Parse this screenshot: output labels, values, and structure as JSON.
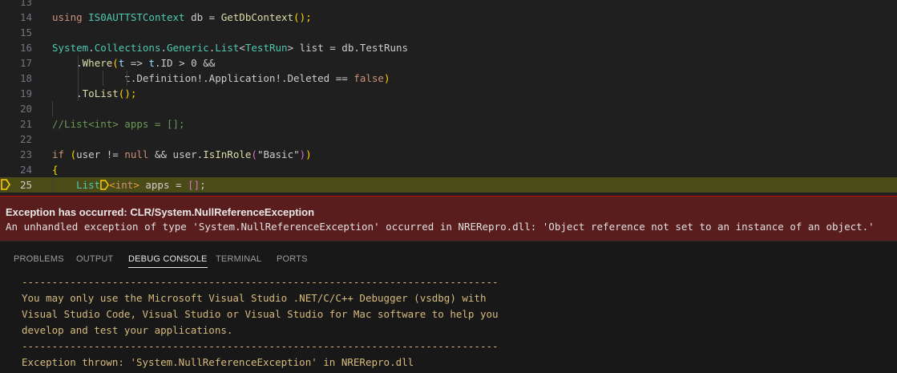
{
  "editor": {
    "lines": [
      {
        "num": "13"
      },
      {
        "num": "14",
        "parts": [
          {
            "t": "using ",
            "c": "kw"
          },
          {
            "t": "IS0AUTTSTContext",
            "c": "typ"
          },
          {
            "t": " db = ",
            "c": "plain"
          },
          {
            "t": "GetDbContext",
            "c": "fn"
          },
          {
            "t": "();",
            "c": "brk1"
          }
        ]
      },
      {
        "num": "15"
      },
      {
        "num": "16",
        "parts": [
          {
            "t": "System",
            "c": "typ"
          },
          {
            "t": ".",
            "c": "plain"
          },
          {
            "t": "Collections",
            "c": "typ"
          },
          {
            "t": ".",
            "c": "plain"
          },
          {
            "t": "Generic",
            "c": "typ"
          },
          {
            "t": ".",
            "c": "plain"
          },
          {
            "t": "List",
            "c": "typ"
          },
          {
            "t": "<",
            "c": "plain"
          },
          {
            "t": "TestRun",
            "c": "typ"
          },
          {
            "t": ">",
            "c": "plain"
          },
          {
            "t": " list = db.TestRuns",
            "c": "plain"
          }
        ]
      },
      {
        "num": "17",
        "parts": [
          {
            "t": "    .",
            "c": "plain"
          },
          {
            "t": "Where",
            "c": "fn"
          },
          {
            "t": "(",
            "c": "brk1"
          },
          {
            "t": "t",
            "c": "var"
          },
          {
            "t": " => ",
            "c": "plain"
          },
          {
            "t": "t",
            "c": "var"
          },
          {
            "t": ".ID > 0 &&",
            "c": "plain"
          }
        ]
      },
      {
        "num": "18",
        "parts": [
          {
            "t": "            t.Definition!.Application!.Deleted == ",
            "c": "plain"
          },
          {
            "t": "false",
            "c": "kw"
          },
          {
            "t": ")",
            "c": "brk1"
          }
        ]
      },
      {
        "num": "19",
        "parts": [
          {
            "t": "    .",
            "c": "plain"
          },
          {
            "t": "ToList",
            "c": "fn"
          },
          {
            "t": "();",
            "c": "brk1"
          }
        ]
      },
      {
        "num": "20"
      },
      {
        "num": "21",
        "parts": [
          {
            "t": "//List<int> apps = [];",
            "c": "cmt"
          }
        ]
      },
      {
        "num": "22"
      },
      {
        "num": "23",
        "parts": [
          {
            "t": "if",
            "c": "kw"
          },
          {
            "t": " ",
            "c": "plain"
          },
          {
            "t": "(",
            "c": "brk1"
          },
          {
            "t": "user != ",
            "c": "plain"
          },
          {
            "t": "null",
            "c": "kw"
          },
          {
            "t": " && user.",
            "c": "plain"
          },
          {
            "t": "IsInRole",
            "c": "fn"
          },
          {
            "t": "(",
            "c": "brk2"
          },
          {
            "t": "\"Basic\"",
            "c": "plain"
          },
          {
            "t": ")",
            "c": "brk2"
          },
          {
            "t": ")",
            "c": "brk1"
          }
        ]
      },
      {
        "num": "24",
        "parts": [
          {
            "t": "{",
            "c": "brk1"
          }
        ]
      },
      {
        "num": "25",
        "current": true,
        "parts": [
          {
            "t": "    List",
            "c": "typ"
          },
          {
            "t": "MARKER",
            "c": "marker"
          },
          {
            "t": "<",
            "c": "org"
          },
          {
            "t": "int",
            "c": "kw"
          },
          {
            "t": ">",
            "c": "org"
          },
          {
            "t": " apps = ",
            "c": "plain"
          },
          {
            "t": "[]",
            "c": "brk2"
          },
          {
            "t": ";",
            "c": "plain"
          }
        ]
      }
    ]
  },
  "exception": {
    "title": "Exception has occurred: CLR/System.NullReferenceException",
    "message": "An unhandled exception of type 'System.NullReferenceException' occurred in NRERepro.dll: 'Object reference not set to an instance of an object.'"
  },
  "panel": {
    "tabs": [
      {
        "label": "PROBLEMS"
      },
      {
        "label": "OUTPUT"
      },
      {
        "label": "DEBUG CONSOLE",
        "active": true
      },
      {
        "label": "TERMINAL"
      },
      {
        "label": "PORTS"
      }
    ],
    "console_lines": [
      "-------------------------------------------------------------------------------",
      "You may only use the Microsoft Visual Studio .NET/C/C++ Debugger (vsdbg) with",
      "Visual Studio Code, Visual Studio or Visual Studio for Mac software to help you",
      "develop and test your applications.",
      "-------------------------------------------------------------------------------",
      "Exception thrown: 'System.NullReferenceException' in NRERepro.dll"
    ]
  },
  "colors": {
    "editor_bg": "#1f1f1f",
    "current_line_bg": "#4b4b18",
    "exception_bg": "#5a1d1d",
    "console_text": "#d7ba7d",
    "breakpoint_marker": "#ffcc00"
  },
  "icons": {
    "gutter_marker": "debug-stackframe-icon",
    "inline_marker": "inline-stop-icon"
  }
}
